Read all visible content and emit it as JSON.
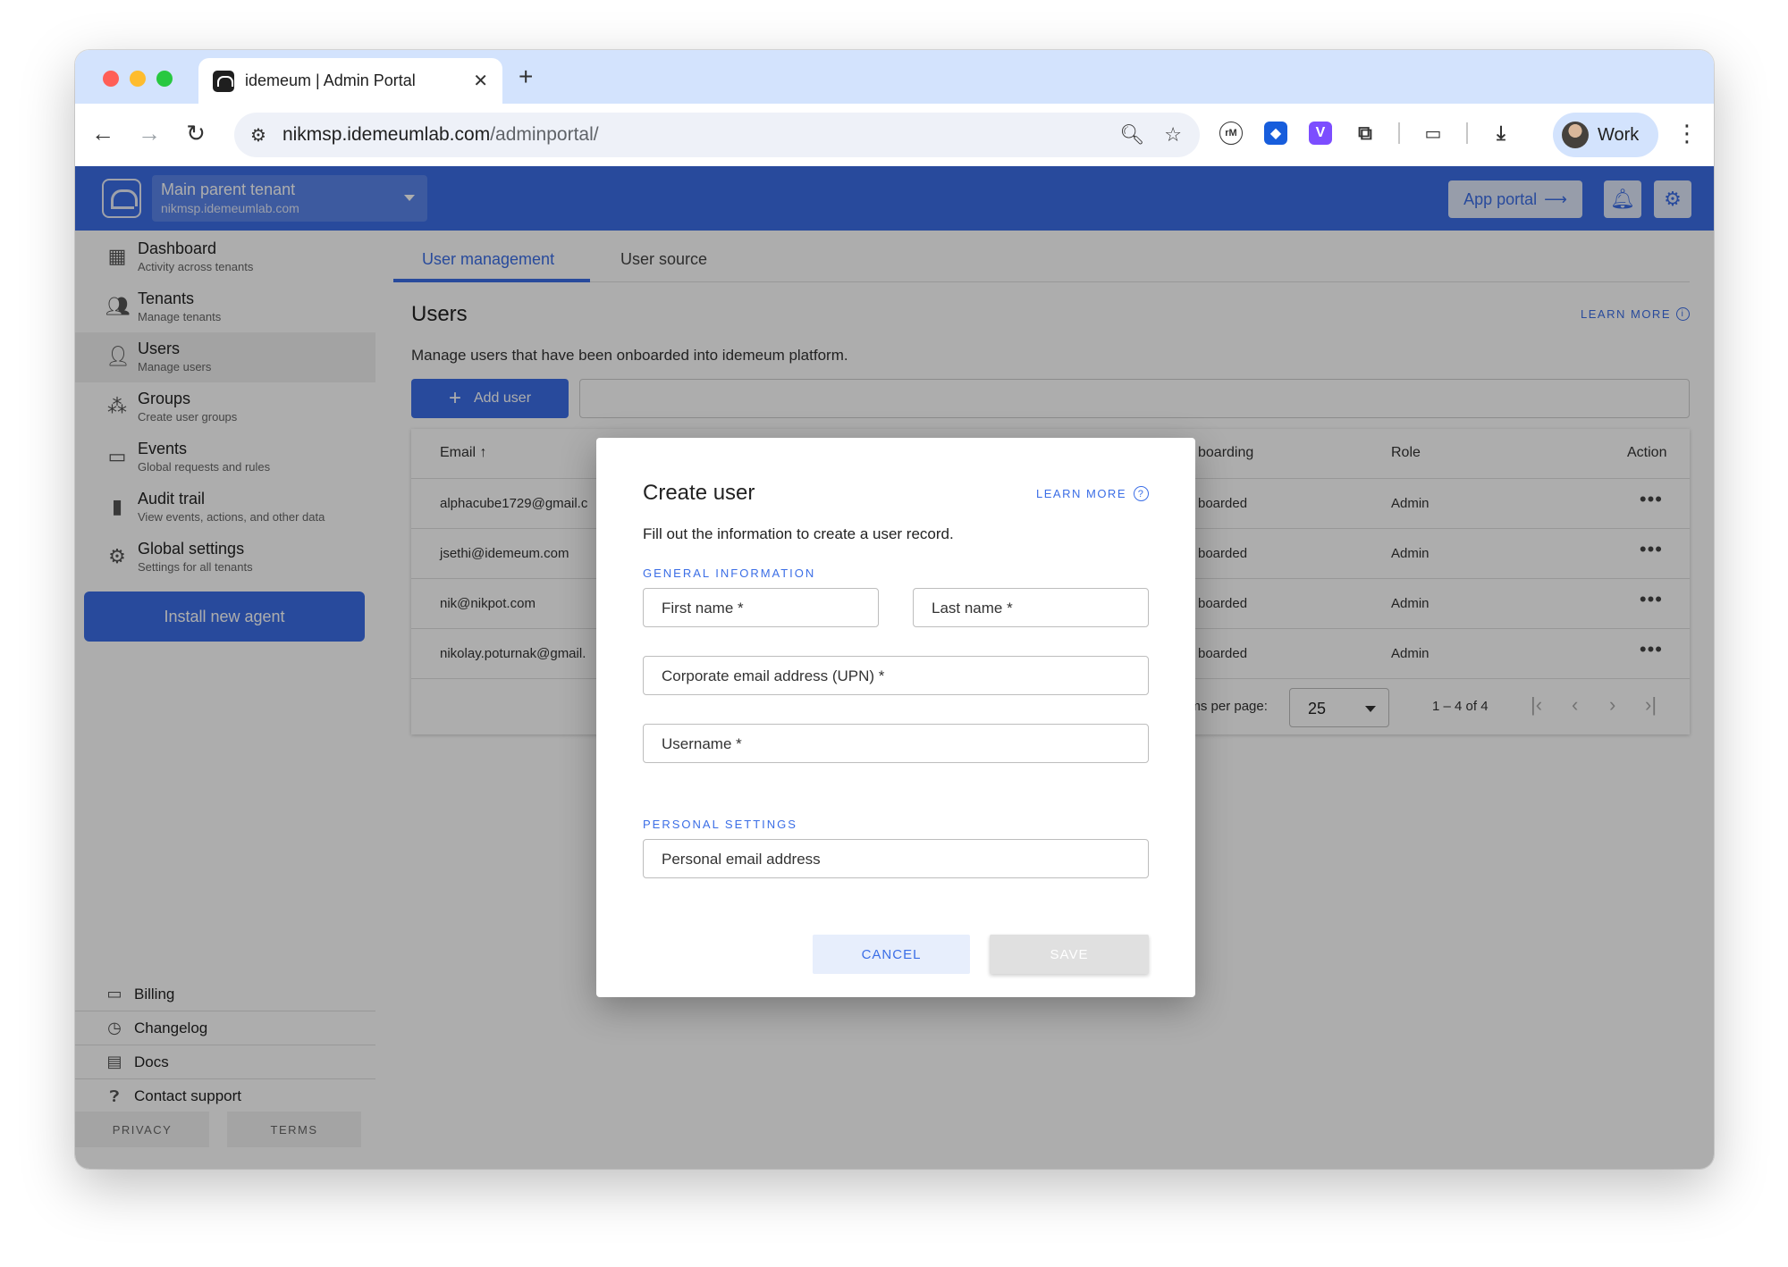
{
  "browser": {
    "tab_title": "idemeum | Admin Portal",
    "url_host": "nikmsp.idemeumlab.com",
    "url_path": "/adminportal/",
    "profile_name": "Work"
  },
  "header": {
    "tenant_name": "Main parent tenant",
    "tenant_host": "nikmsp.idemeumlab.com",
    "app_portal_label": "App portal",
    "brand_color": "#3b6ee6"
  },
  "sidebar": {
    "items": [
      {
        "title": "Dashboard",
        "subtitle": "Activity across tenants",
        "icon": "dashboard-icon"
      },
      {
        "title": "Tenants",
        "subtitle": "Manage tenants",
        "icon": "tenants-icon"
      },
      {
        "title": "Users",
        "subtitle": "Manage users",
        "icon": "user-icon"
      },
      {
        "title": "Groups",
        "subtitle": "Create user groups",
        "icon": "groups-icon"
      },
      {
        "title": "Events",
        "subtitle": "Global requests and rules",
        "icon": "devices-icon"
      },
      {
        "title": "Audit trail",
        "subtitle": "View events, actions, and other data",
        "icon": "bar-chart-icon"
      },
      {
        "title": "Global settings",
        "subtitle": "Settings for all tenants",
        "icon": "gear-icon"
      }
    ],
    "active_item": "Users",
    "install_button": "Install new agent",
    "footer_links": [
      {
        "label": "Billing",
        "icon": "card-icon"
      },
      {
        "label": "Changelog",
        "icon": "history-icon"
      },
      {
        "label": "Docs",
        "icon": "document-icon"
      },
      {
        "label": "Contact support",
        "icon": "help-icon"
      }
    ],
    "privacy": "PRIVACY",
    "terms": "TERMS"
  },
  "main": {
    "tabs": [
      "User management",
      "User source"
    ],
    "heading": "Users",
    "learn_more": "LEARN MORE",
    "description": "Manage users that have been onboarded into idemeum platform.",
    "add_user": "Add user",
    "columns": {
      "email": "Email",
      "onboarding": "boarding",
      "role": "Role",
      "action": "Action"
    },
    "rows": [
      {
        "email": "alphacube1729@gmail.c",
        "onboarding": "boarded",
        "role": "Admin"
      },
      {
        "email": "jsethi@idemeum.com",
        "onboarding": "boarded",
        "role": "Admin"
      },
      {
        "email": "nik@nikpot.com",
        "onboarding": "boarded",
        "role": "Admin"
      },
      {
        "email": "nikolay.poturnak@gmail.",
        "onboarding": "boarded",
        "role": "Admin"
      }
    ],
    "pager": {
      "items_per_page_label": "ems per page:",
      "items_per_page": "25",
      "range": "1 – 4 of 4"
    }
  },
  "dialog": {
    "title": "Create user",
    "learn_more": "LEARN MORE",
    "description": "Fill out the information to create a user record.",
    "general_section": "GENERAL INFORMATION",
    "first_name_placeholder": "First name *",
    "last_name_placeholder": "Last name *",
    "corporate_email_placeholder": "Corporate email address (UPN) *",
    "username_placeholder": "Username *",
    "personal_section": "PERSONAL SETTINGS",
    "personal_email_placeholder": "Personal email address",
    "cancel": "CANCEL",
    "save": "SAVE"
  }
}
